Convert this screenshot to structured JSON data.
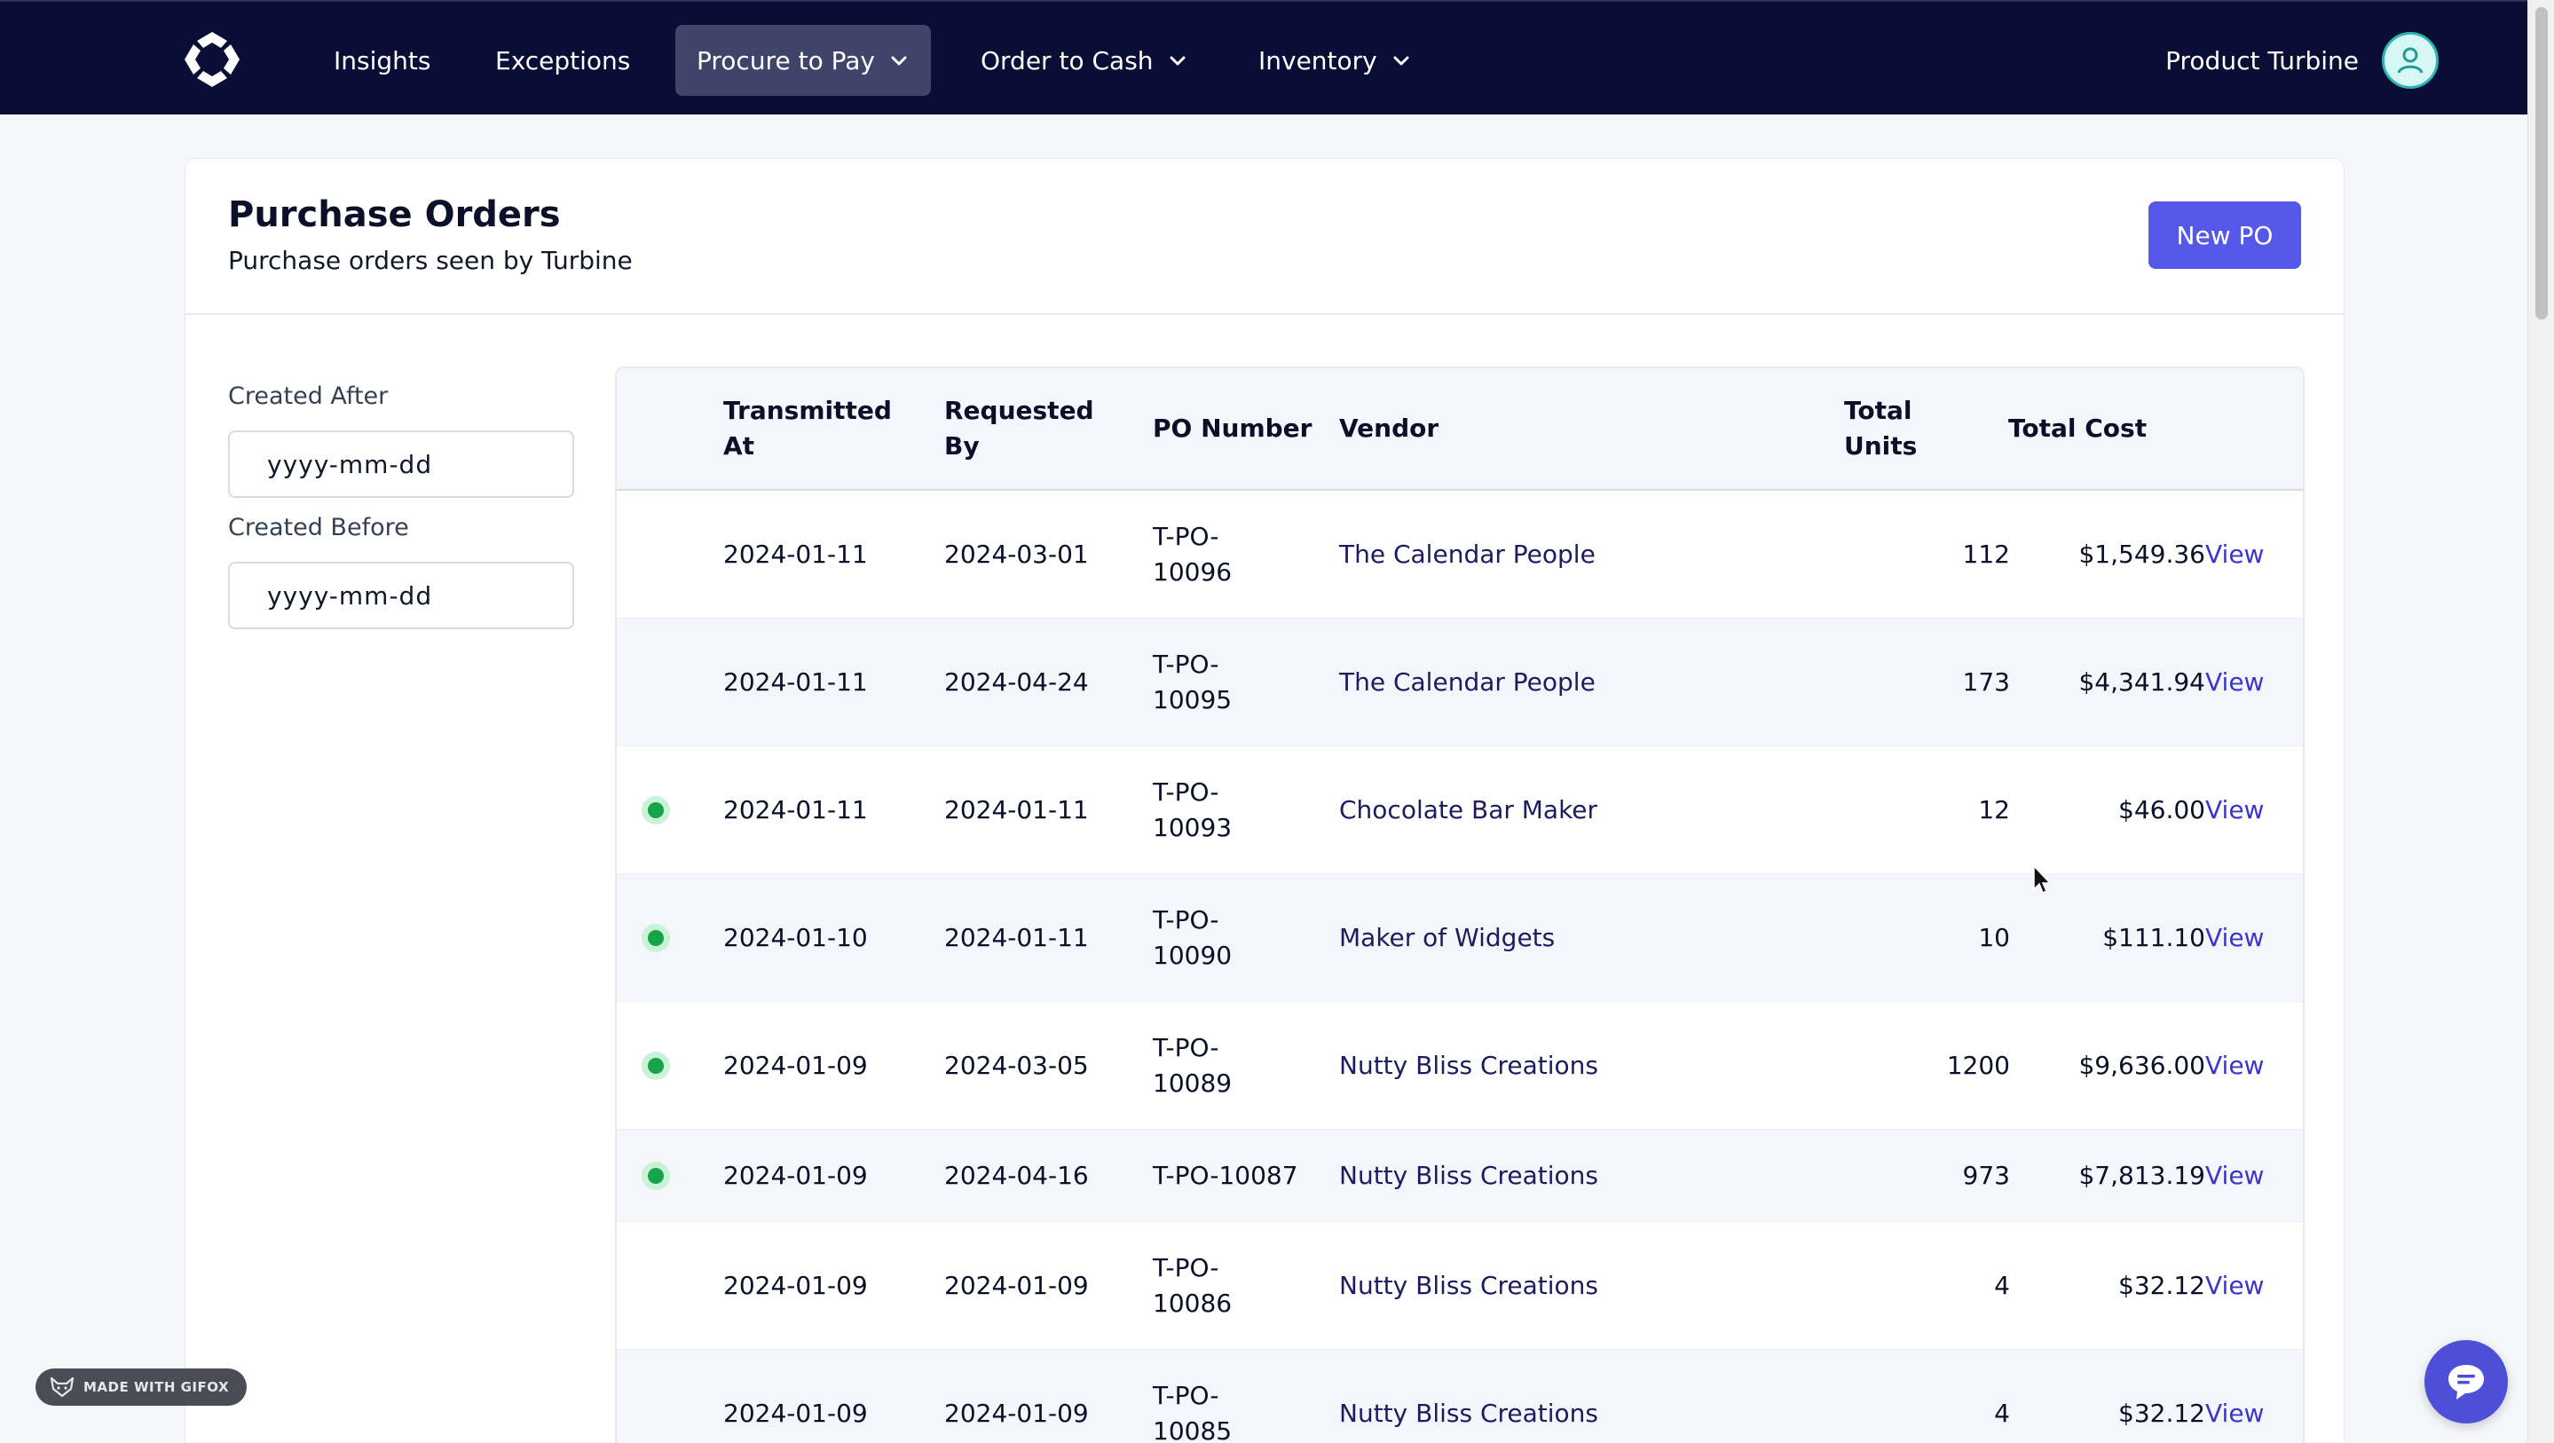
{
  "nav": {
    "items": [
      {
        "label": "Insights"
      },
      {
        "label": "Exceptions"
      },
      {
        "label": "Procure to Pay",
        "active": true
      },
      {
        "label": "Order to Cash"
      },
      {
        "label": "Inventory"
      }
    ],
    "user_name": "Product Turbine"
  },
  "page": {
    "title": "Purchase Orders",
    "subtitle": "Purchase orders seen by Turbine",
    "new_button": "New PO"
  },
  "filters": {
    "created_after_label": "Created After",
    "created_after_placeholder": "yyyy-mm-dd",
    "created_before_label": "Created Before",
    "created_before_placeholder": "yyyy-mm-dd"
  },
  "table": {
    "headers": {
      "transmitted_at": [
        "Transmitted",
        "At"
      ],
      "requested_by": [
        "Requested",
        "By"
      ],
      "po_number": "PO Number",
      "vendor": "Vendor",
      "total_units": [
        "Total",
        "Units"
      ],
      "total_cost": "Total Cost"
    },
    "rows": [
      {
        "status": false,
        "transmitted": "2024-01-11",
        "requested": "2024-03-01",
        "po": [
          "T-PO-",
          "10096"
        ],
        "vendor": "The Calendar People",
        "units": "112",
        "cost": "$1,549.36",
        "action": "View"
      },
      {
        "status": false,
        "transmitted": "2024-01-11",
        "requested": "2024-04-24",
        "po": [
          "T-PO-",
          "10095"
        ],
        "vendor": "The Calendar People",
        "units": "173",
        "cost": "$4,341.94",
        "action": "View"
      },
      {
        "status": true,
        "transmitted": "2024-01-11",
        "requested": "2024-01-11",
        "po": [
          "T-PO-",
          "10093"
        ],
        "vendor": "Chocolate Bar Maker",
        "units": "12",
        "cost": "$46.00",
        "action": "View"
      },
      {
        "status": true,
        "transmitted": "2024-01-10",
        "requested": "2024-01-11",
        "po": [
          "T-PO-",
          "10090"
        ],
        "vendor": "Maker of Widgets",
        "units": "10",
        "cost": "$111.10",
        "action": "View"
      },
      {
        "status": true,
        "transmitted": "2024-01-09",
        "requested": "2024-03-05",
        "po": [
          "T-PO-",
          "10089"
        ],
        "vendor": "Nutty Bliss Creations",
        "units": "1200",
        "cost": "$9,636.00",
        "action": "View"
      },
      {
        "status": true,
        "transmitted": "2024-01-09",
        "requested": "2024-04-16",
        "po": [
          "T-PO-10087"
        ],
        "vendor": "Nutty Bliss Creations",
        "units": "973",
        "cost": "$7,813.19",
        "action": "View"
      },
      {
        "status": false,
        "transmitted": "2024-01-09",
        "requested": "2024-01-09",
        "po": [
          "T-PO-",
          "10086"
        ],
        "vendor": "Nutty Bliss Creations",
        "units": "4",
        "cost": "$32.12",
        "action": "View"
      },
      {
        "status": false,
        "transmitted": "2024-01-09",
        "requested": "2024-01-09",
        "po": [
          "T-PO-",
          "10085"
        ],
        "vendor": "Nutty Bliss Creations",
        "units": "4",
        "cost": "$32.12",
        "action": "View"
      }
    ]
  },
  "badge": {
    "label": "MADE WITH GIFOX"
  },
  "icons": {
    "logo": "turbine-logo-icon",
    "chevron": "chevron-down-icon",
    "avatar": "user-avatar-icon",
    "calendar": "calendar-icon",
    "chat": "chat-icon",
    "fox": "fox-icon"
  },
  "colors": {
    "nav_bg": "#0a0d35",
    "nav_active": "#3f4468",
    "accent": "#5558e8",
    "link": "#3a36c9",
    "status_green": "#16a34a"
  }
}
